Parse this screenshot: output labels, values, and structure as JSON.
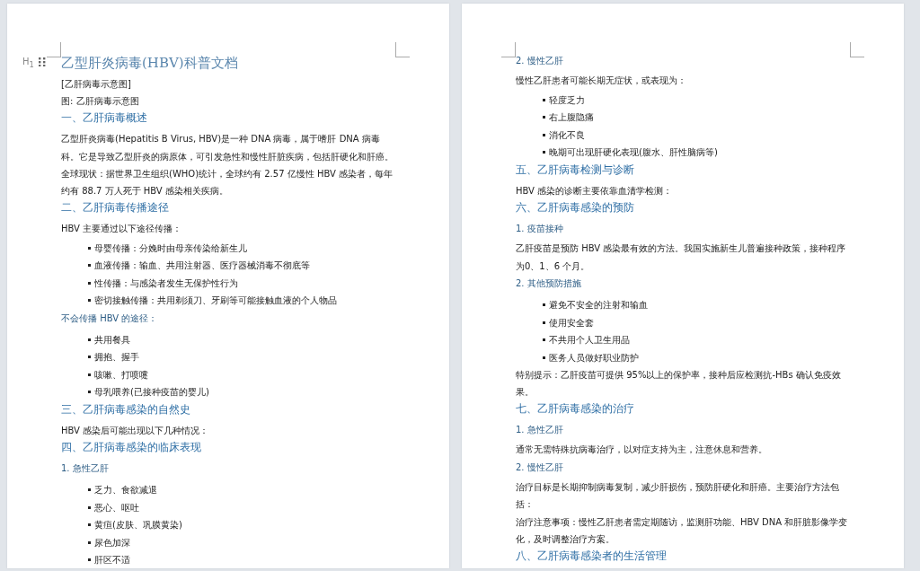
{
  "pages": [
    {
      "blocks": [
        {
          "kind": "title",
          "text": "乙型肝炎病毒(HBV)科普文档",
          "marker": "H$_{1}$"
        },
        {
          "kind": "caption",
          "text": "[乙肝病毒示意图]"
        },
        {
          "kind": "caption",
          "text": "图: 乙肝病毒示意图"
        },
        {
          "kind": "heading",
          "text": "一、乙肝病毒概述"
        },
        {
          "kind": "text",
          "text": "乙型肝炎病毒(Hepatitis B Virus, HBV)是一种 DNA 病毒，属于嗜肝 DNA 病毒科。它是导致乙型肝炎的病原体，可引发急性和慢性肝脏疾病，包括肝硬化和肝癌。"
        },
        {
          "kind": "caption",
          "text": "全球现状：据世界卫生组织(WHO)统计，全球约有 2.57 亿慢性 HBV 感染者，每年约有 88.7 万人死于 HBV 感染相关疾病。"
        },
        {
          "kind": "heading",
          "text": "二、乙肝病毒传播途径"
        },
        {
          "kind": "text",
          "text": "HBV 主要通过以下途径传播："
        },
        {
          "kind": "bullets",
          "items": [
            "母婴传播：分娩时由母亲传染给新生儿",
            "血液传播：输血、共用注射器、医疗器械消毒不彻底等",
            "性传播：与感染者发生无保护性行为",
            "密切接触传播：共用剃须刀、牙刷等可能接触血液的个人物品"
          ]
        },
        {
          "kind": "subheading",
          "text": "不会传播 HBV 的途径："
        },
        {
          "kind": "bullets",
          "items": [
            "共用餐具",
            "拥抱、握手",
            "咳嗽、打喷嚏",
            "母乳喂养(已接种疫苗的婴儿)"
          ]
        },
        {
          "kind": "heading",
          "text": "三、乙肝病毒感染的自然史"
        },
        {
          "kind": "text",
          "text": "HBV 感染后可能出现以下几种情况："
        },
        {
          "kind": "heading",
          "text": "四、乙肝病毒感染的临床表现"
        },
        {
          "kind": "subheading",
          "text": "1. 急性乙肝"
        },
        {
          "kind": "bullets",
          "items": [
            "乏力、食欲减退",
            "恶心、呕吐",
            "黄疸(皮肤、巩膜黄染)",
            "尿色加深",
            "肝区不适"
          ]
        }
      ]
    },
    {
      "blocks": [
        {
          "kind": "subheading",
          "text": "2. 慢性乙肝"
        },
        {
          "kind": "text",
          "text": "慢性乙肝患者可能长期无症状，或表现为："
        },
        {
          "kind": "bullets",
          "items": [
            "轻度乏力",
            "右上腹隐痛",
            "消化不良",
            "晚期可出现肝硬化表现(腹水、肝性脑病等)"
          ]
        },
        {
          "kind": "heading",
          "text": "五、乙肝病毒检测与诊断"
        },
        {
          "kind": "text",
          "text": "HBV 感染的诊断主要依靠血清学检测："
        },
        {
          "kind": "heading",
          "text": "六、乙肝病毒感染的预防"
        },
        {
          "kind": "subheading",
          "text": "1. 疫苗接种"
        },
        {
          "kind": "text",
          "text": "乙肝疫苗是预防 HBV 感染最有效的方法。我国实施新生儿普遍接种政策，接种程序为0、1、6 个月。"
        },
        {
          "kind": "subheading",
          "text": "2. 其他预防措施"
        },
        {
          "kind": "bullets",
          "items": [
            "避免不安全的注射和输血",
            "使用安全套",
            "不共用个人卫生用品",
            "医务人员做好职业防护"
          ]
        },
        {
          "kind": "caption",
          "text": "特别提示：乙肝疫苗可提供 95%以上的保护率，接种后应检测抗-HBs 确认免疫效果。"
        },
        {
          "kind": "heading",
          "text": "七、乙肝病毒感染的治疗"
        },
        {
          "kind": "subheading",
          "text": "1. 急性乙肝"
        },
        {
          "kind": "text",
          "text": "通常无需特殊抗病毒治疗，以对症支持为主，注意休息和营养。"
        },
        {
          "kind": "subheading",
          "text": "2. 慢性乙肝"
        },
        {
          "kind": "text",
          "text": "治疗目标是长期抑制病毒复制，减少肝损伤，预防肝硬化和肝癌。主要治疗方法包括："
        },
        {
          "kind": "caption",
          "text": "治疗注意事项：慢性乙肝患者需定期随访，监测肝功能、HBV DNA 和肝脏影像学变化，及时调整治疗方案。"
        },
        {
          "kind": "heading",
          "text": "八、乙肝病毒感染者的生活管理"
        }
      ]
    }
  ]
}
